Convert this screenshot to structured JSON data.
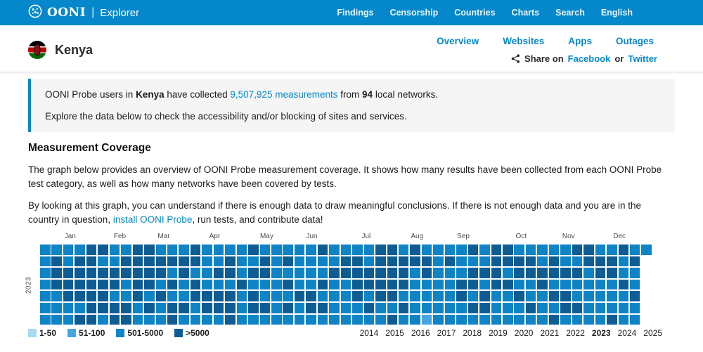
{
  "navbar": {
    "brand": "OONI",
    "product": "Explorer",
    "links": [
      "Findings",
      "Censorship",
      "Countries",
      "Charts",
      "Search",
      "English"
    ],
    "bg_color": "#0588CB"
  },
  "header": {
    "country": "Kenya",
    "tabs": [
      "Overview",
      "Websites",
      "Apps",
      "Outages"
    ],
    "share": {
      "prefix": "Share on",
      "facebook": "Facebook",
      "or": "or",
      "twitter": "Twitter"
    }
  },
  "summary": {
    "line1_pre": "OONI Probe users in ",
    "country": "Kenya",
    "line1_collected": " have collected ",
    "measurements_link": "9,507,925 measurements",
    "line1_from": " from ",
    "networks": "94",
    "line1_post": " local networks.",
    "line2": "Explore the data below to check the accessibility and/or blocking of sites and services."
  },
  "coverage": {
    "title": "Measurement Coverage",
    "para1": "The graph below provides an overview of OONI Probe measurement coverage. It shows how many results have been collected from each OONI Probe test category, as well as how many networks have been covered by tests.",
    "para2_pre": "By looking at this graph, you can understand if there is enough data to draw meaningful conclusions. If there is not enough data and you are in the country in question, ",
    "install_link": "install OONI Probe",
    "para2_post": ", run tests, and contribute data!"
  },
  "chart_data": {
    "type": "heatmap",
    "title": "OONI Probe measurement coverage per day, calendar heatmap for 2023",
    "year_label": "2023",
    "months": [
      "Jan",
      "Feb",
      "Mar",
      "Apr",
      "May",
      "Jun",
      "Jul",
      "Aug",
      "Sep",
      "Oct",
      "Nov",
      "Dec"
    ],
    "weeks": 53,
    "rows": 7,
    "row_meaning": "days of week, top row = Sunday; columns = weeks of 2023",
    "legend": [
      {
        "label": "1-50",
        "color": "#a7d9f2"
      },
      {
        "label": "51-100",
        "color": "#47a6e0"
      },
      {
        "label": "501-5000",
        "color": "#0e84c6"
      },
      {
        "label": ">5000",
        "color": "#0e5c94"
      }
    ],
    "value_meaning": {
      "0": "no day in this year",
      "1": "51-100",
      "2": "501-5000",
      "3": ">5000"
    },
    "level_colors": {
      "1": "#47a6e0",
      "2": "#0e84c6",
      "3": "#0e5c94"
    },
    "grid": [
      [
        2,
        2,
        2,
        2,
        3,
        3,
        2,
        2,
        3,
        3,
        2,
        2,
        2,
        3,
        2,
        2,
        2,
        2,
        3,
        2,
        2,
        2,
        2,
        2,
        3,
        2,
        2,
        2,
        2,
        3,
        3,
        2,
        3,
        2,
        2,
        2,
        2,
        3,
        2,
        3,
        3,
        2,
        2,
        2,
        2,
        2,
        3,
        3,
        2,
        2,
        3,
        2,
        2
      ],
      [
        2,
        3,
        2,
        3,
        3,
        2,
        2,
        3,
        3,
        3,
        3,
        3,
        3,
        3,
        2,
        2,
        3,
        2,
        2,
        3,
        2,
        3,
        2,
        2,
        2,
        2,
        3,
        3,
        2,
        3,
        3,
        3,
        3,
        3,
        2,
        3,
        2,
        2,
        2,
        3,
        3,
        3,
        3,
        2,
        3,
        2,
        2,
        3,
        3,
        3,
        2,
        3,
        0
      ],
      [
        2,
        3,
        3,
        3,
        3,
        3,
        3,
        3,
        3,
        3,
        3,
        2,
        3,
        2,
        2,
        3,
        3,
        2,
        3,
        3,
        2,
        2,
        2,
        2,
        2,
        3,
        3,
        3,
        3,
        3,
        3,
        3,
        2,
        3,
        2,
        2,
        2,
        3,
        3,
        3,
        2,
        3,
        3,
        3,
        3,
        3,
        3,
        2,
        3,
        3,
        2,
        2,
        0
      ],
      [
        2,
        3,
        3,
        3,
        3,
        3,
        3,
        2,
        3,
        3,
        2,
        3,
        2,
        3,
        2,
        2,
        2,
        3,
        2,
        2,
        2,
        3,
        2,
        2,
        3,
        2,
        2,
        3,
        3,
        3,
        3,
        3,
        2,
        2,
        2,
        2,
        3,
        3,
        2,
        3,
        3,
        2,
        2,
        3,
        2,
        2,
        2,
        2,
        2,
        2,
        3,
        2,
        0
      ],
      [
        2,
        2,
        3,
        3,
        3,
        3,
        2,
        2,
        3,
        2,
        3,
        2,
        2,
        3,
        3,
        3,
        3,
        2,
        3,
        2,
        2,
        2,
        3,
        3,
        2,
        2,
        2,
        3,
        2,
        3,
        3,
        2,
        2,
        2,
        2,
        2,
        3,
        2,
        3,
        2,
        2,
        3,
        2,
        2,
        3,
        3,
        2,
        2,
        2,
        2,
        2,
        3,
        0
      ],
      [
        2,
        2,
        2,
        2,
        3,
        3,
        3,
        3,
        2,
        3,
        2,
        3,
        3,
        2,
        3,
        3,
        3,
        2,
        3,
        3,
        2,
        3,
        2,
        3,
        3,
        2,
        2,
        2,
        3,
        2,
        2,
        3,
        2,
        2,
        2,
        2,
        2,
        3,
        3,
        2,
        2,
        2,
        3,
        2,
        2,
        3,
        3,
        2,
        2,
        2,
        2,
        2,
        0
      ],
      [
        2,
        2,
        2,
        3,
        3,
        2,
        3,
        3,
        2,
        2,
        2,
        3,
        2,
        2,
        2,
        2,
        3,
        2,
        2,
        2,
        2,
        2,
        2,
        2,
        2,
        2,
        2,
        2,
        2,
        2,
        3,
        2,
        2,
        1,
        2,
        2,
        2,
        2,
        2,
        2,
        2,
        2,
        2,
        2,
        3,
        2,
        2,
        2,
        2,
        3,
        2,
        2,
        0
      ]
    ],
    "years": [
      "2014",
      "2015",
      "2016",
      "2017",
      "2018",
      "2019",
      "2020",
      "2021",
      "2022",
      "2023",
      "2024",
      "2025"
    ],
    "selected_year": "2023"
  }
}
